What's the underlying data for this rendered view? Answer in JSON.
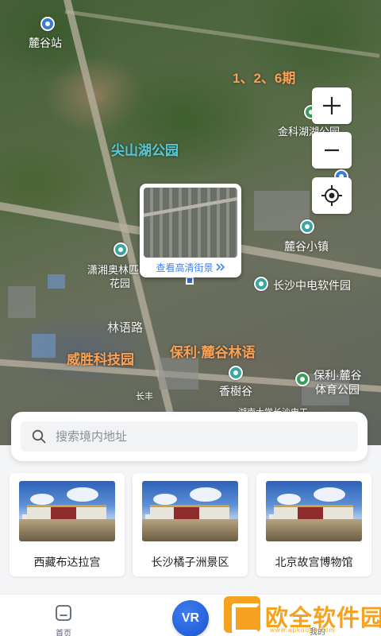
{
  "map": {
    "labels": {
      "lugu_station": "麓谷站",
      "phases": "1、2、6期",
      "jinke_park": "金科湖湖公园",
      "jianshan_park": "尖山湖公园",
      "lugu_town": "麓谷小镇",
      "xiaoxiang_1": "潇湘奥林匹",
      "xiaoxiang_2": "花园",
      "changsha_cec": "长沙中电软件园",
      "linyu_road": "林语路",
      "weisheng_park": "威胜科技园",
      "poly_linyu": "保利·麓谷林语",
      "poly_sports_1": "保利·麓谷",
      "poly_sports_2": "体育公园",
      "xiangshugu": "香樹谷",
      "changfeng": "长丰",
      "hunan_univ": "湖南大学长沙电工"
    },
    "streetview_label": "查看高清街景",
    "controls": {
      "zoom_in": "+",
      "zoom_out": "−"
    }
  },
  "search": {
    "placeholder": "搜索境内地址"
  },
  "attractions": [
    {
      "title": "西藏布达拉宫"
    },
    {
      "title": "长沙橘子洲景区"
    },
    {
      "title": "北京故宫博物馆"
    }
  ],
  "nav": {
    "home": "首页",
    "vr": "VR",
    "mine": "我的"
  },
  "watermark": {
    "name": "欧全软件园",
    "url": "www.apkoujin.com"
  },
  "colors": {
    "accent": "#3b82f6",
    "watermark": "#f4a21f"
  }
}
